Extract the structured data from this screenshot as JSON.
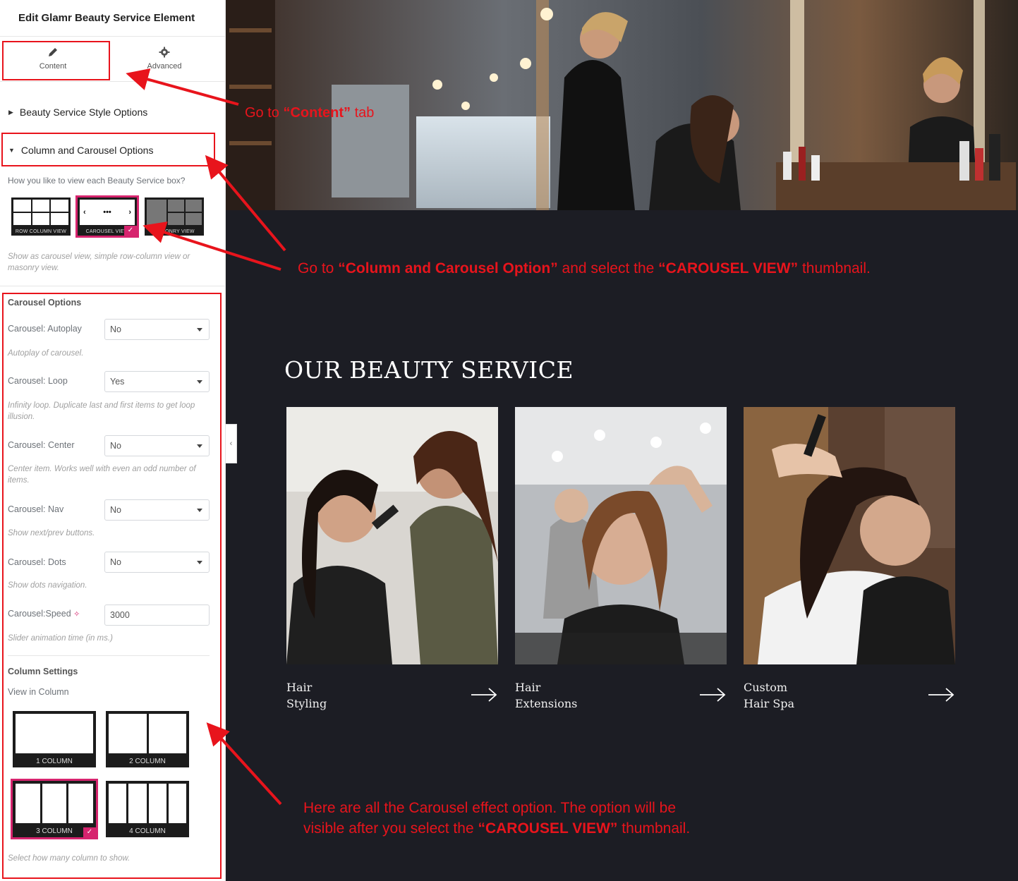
{
  "sidebar": {
    "header_title": "Edit Glamr Beauty Service Element",
    "tabs": [
      {
        "label": "Content",
        "icon": "pencil-icon"
      },
      {
        "label": "Advanced",
        "icon": "gear-icon"
      }
    ],
    "sections": {
      "style_options": "Beauty Service Style Options",
      "column_carousel": "Column and Carousel Options"
    },
    "view_prompt": "How you like to view each Beauty Service box?",
    "view_options": [
      {
        "label": "ROW COLUMN VIEW",
        "selected": false
      },
      {
        "label": "CAROUSEL VIEW",
        "selected": true
      },
      {
        "label": "MASONRY VIEW",
        "selected": false
      }
    ],
    "view_help": "Show as carousel view, simple row-column view or masonry view.",
    "carousel_title": "Carousel Options",
    "carousel_fields": [
      {
        "label": "Carousel: Autoplay",
        "value": "No",
        "help": "Autoplay of carousel."
      },
      {
        "label": "Carousel: Loop",
        "value": "Yes",
        "help": "Infinity loop. Duplicate last and first items to get loop illusion."
      },
      {
        "label": "Carousel: Center",
        "value": "No",
        "help": "Center item. Works well with even an odd number of items."
      },
      {
        "label": "Carousel: Nav",
        "value": "No",
        "help": "Show next/prev buttons."
      },
      {
        "label": "Carousel: Dots",
        "value": "No",
        "help": "Show dots navigation."
      }
    ],
    "speed": {
      "label": "Carousel:Speed",
      "value": "3000",
      "help": "Slider animation time (in ms.)"
    },
    "column_title": "Column Settings",
    "column_label": "View in Column",
    "column_options": [
      {
        "label": "1 COLUMN",
        "selected": false
      },
      {
        "label": "2 COLUMN",
        "selected": false
      },
      {
        "label": "3 COLUMN",
        "selected": true
      },
      {
        "label": "4 COLUMN",
        "selected": false
      }
    ],
    "column_help": "Select how many column to show."
  },
  "preview": {
    "section_title": "OUR BEAUTY SERVICE",
    "services": [
      {
        "name": "Hair\nStyling"
      },
      {
        "name": "Hair\nExtensions"
      },
      {
        "name": "Custom\nHair Spa"
      }
    ]
  },
  "annotations": {
    "content_tab": {
      "pre": "Go  to ",
      "bold": "“Content”",
      "post": " tab"
    },
    "carousel_view": {
      "pre": "Go to ",
      "bold1": "“Column and Carousel Option”",
      "mid": " and select the ",
      "bold2": "“CAROUSEL VIEW”",
      "post": " thumbnail."
    },
    "options_line1": "Here are all the Carousel effect option. The option will be",
    "options_line2_pre": "visible after you select the ",
    "options_line2_bold": "“CAROUSEL VIEW”",
    "options_line2_post": " thumbnail."
  },
  "colors": {
    "accent": "#d6246e",
    "annotation_red": "#e8141c",
    "preview_bg": "#1c1d24"
  }
}
